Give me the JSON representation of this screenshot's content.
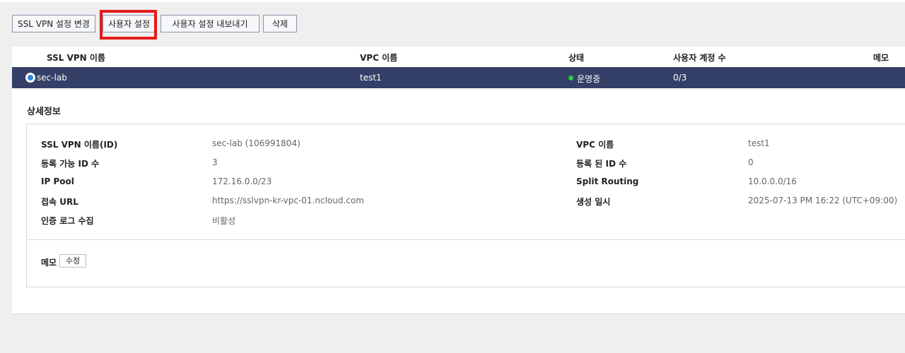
{
  "toolbar": {
    "change_settings": "SSL VPN 설정 변경",
    "user_settings": "사용자 설정",
    "export_user_settings": "사용자 설정 내보내기",
    "delete": "삭제"
  },
  "table": {
    "columns": [
      "SSL VPN 이름",
      "VPC 이름",
      "상태",
      "사용자 계정 수",
      "메모"
    ],
    "rows": [
      {
        "name": "sec-lab",
        "vpc": "test1",
        "status": "운영중",
        "user_count": "0/3",
        "memo": ""
      }
    ]
  },
  "colors": {
    "status_running": "#2ecc40",
    "selected_row": "#344067",
    "highlight": "#e31b1b"
  },
  "details": {
    "title": "상세정보",
    "left": [
      {
        "label": "SSL VPN 이름(ID)",
        "value": "sec-lab (106991804)"
      },
      {
        "label": "등록 가능 ID 수",
        "value": "3"
      },
      {
        "label": "IP Pool",
        "value": "172.16.0.0/23"
      },
      {
        "label": "접속 URL",
        "value": "https://sslvpn-kr-vpc-01.ncloud.com"
      },
      {
        "label": "인증 로그 수집",
        "value": "비활성"
      }
    ],
    "right": [
      {
        "label": "VPC 이름",
        "value": "test1"
      },
      {
        "label": "등록 된 ID 수",
        "value": "0"
      },
      {
        "label": "Split Routing",
        "value": "10.0.0.0/16"
      },
      {
        "label": "생성 일시",
        "value": "2025-07-13 PM 16:22 (UTC+09:00)"
      }
    ],
    "memo_label": "메모",
    "memo_edit": "수정"
  }
}
